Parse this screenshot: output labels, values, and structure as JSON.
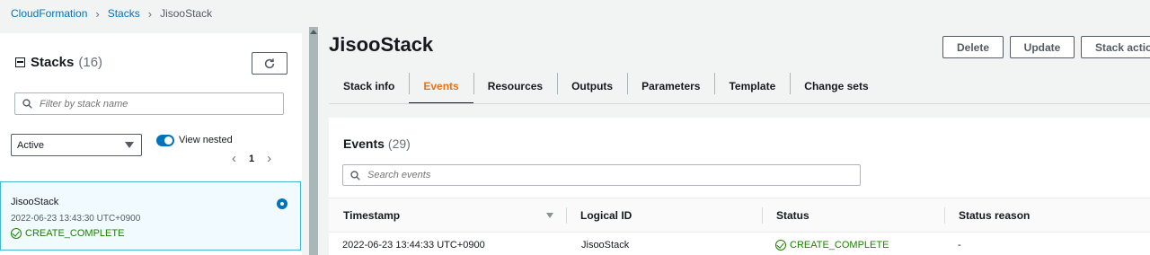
{
  "breadcrumb": {
    "root": "CloudFormation",
    "stacks": "Stacks",
    "current": "JisooStack"
  },
  "left_panel": {
    "heading": "Stacks",
    "count": "(16)",
    "filter_placeholder": "Filter by stack name",
    "status_filter": "Active",
    "view_nested_label": "View nested",
    "view_nested_on": true,
    "page": "1",
    "stacks": [
      {
        "name": "JisooStack",
        "created": "2022-06-23 13:43:30 UTC+0900",
        "status": "CREATE_COMPLETE",
        "selected": true
      }
    ]
  },
  "stack": {
    "title": "JisooStack",
    "actions": {
      "delete": "Delete",
      "update": "Update",
      "stack_actions": "Stack actions"
    },
    "tabs": [
      "Stack info",
      "Events",
      "Resources",
      "Outputs",
      "Parameters",
      "Template",
      "Change sets"
    ],
    "active_tab": "Events"
  },
  "events": {
    "heading": "Events",
    "count": "(29)",
    "search_placeholder": "Search events",
    "columns": [
      "Timestamp",
      "Logical ID",
      "Status",
      "Status reason"
    ],
    "rows": [
      {
        "timestamp": "2022-06-23 13:44:33 UTC+0900",
        "logical_id": "JisooStack",
        "status": "CREATE_COMPLETE",
        "reason": "-"
      }
    ]
  },
  "colors": {
    "link": "#0073bb",
    "accent": "#ec7211",
    "success": "#1d8102"
  },
  "icons": [
    "chevron-right-icon",
    "collapse-icon",
    "refresh-icon",
    "search-icon",
    "caret-down-icon",
    "toggle-icon",
    "chevron-left-icon",
    "radio-selected-icon",
    "check-circle-icon",
    "sort-caret-icon"
  ]
}
